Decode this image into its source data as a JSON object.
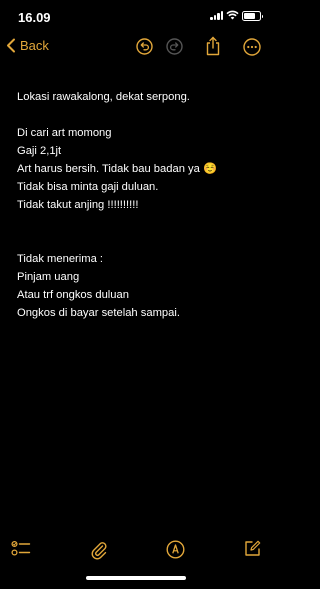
{
  "status": {
    "time": "16.09",
    "battery_level": 0.75
  },
  "nav": {
    "back_label": "Back"
  },
  "note": {
    "lines": [
      "Lokasi rawakalong, dekat serpong.",
      "",
      "Di cari art momong",
      "Gaji 2,1jt",
      "Art harus bersih. Tidak bau badan ya ☺️",
      "Tidak bisa minta gaji duluan.",
      "Tidak takut anjing !!!!!!!!!!",
      "",
      "",
      "Tidak menerima :",
      "Pinjam uang",
      "Atau trf ongkos duluan",
      "Ongkos di bayar setelah sampai."
    ]
  },
  "colors": {
    "accent": "#e2a73a",
    "background": "#000000",
    "text": "#ffffff"
  },
  "icons": {
    "nav": [
      "undo-icon",
      "redo-icon",
      "share-icon",
      "more-icon"
    ],
    "toolbar": [
      "checklist-icon",
      "attachment-icon",
      "markup-icon",
      "compose-icon"
    ]
  }
}
